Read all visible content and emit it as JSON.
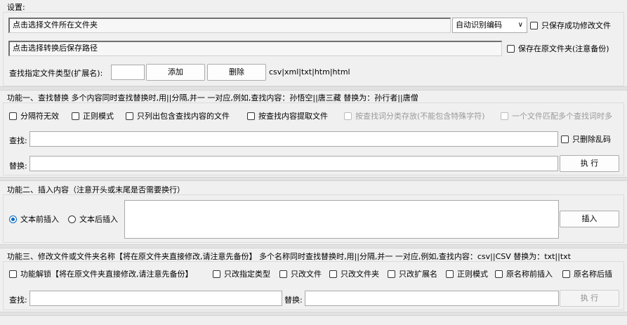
{
  "settings": {
    "title": "设置:",
    "source_path": "点击选择文件所在文件夹",
    "encoding": "自动识别编码",
    "encoding_chevron": "∨",
    "only_save_success": "只保存成功修改文件",
    "target_path": "点击选择转换后保存路径",
    "save_in_original": "保存在原文件夹(注意备份)",
    "ext_label": "查找指定文件类型(扩展名):",
    "ext_value": "",
    "add_btn": "添加",
    "delete_btn": "删除",
    "ext_list": "csv|xml|txt|htm|html"
  },
  "f1": {
    "title": "功能一、查找替换 多个内容同时查找替换时,用||分隔,并一 一对应,例如,查找内容：孙悟空||唐三藏 替换为：孙行者||唐僧",
    "opt_sep_invalid": "分隔符无效",
    "opt_regex": "正则模式",
    "opt_list_only": "只列出包含查找内容的文件",
    "opt_extract": "按查找内容提取文件",
    "opt_classify": "按查找词分类存放(不能包含特殊字符)",
    "opt_multi": "一个文件匹配多个查找词时多",
    "find_label": "查找:",
    "find_value": "",
    "only_delete_garbled": "只删除乱码",
    "replace_label": "替换:",
    "replace_value": "",
    "exec_btn": "执 行"
  },
  "f2": {
    "title": "功能二、插入内容（注意开头或末尾是否需要换行）",
    "radio_before": "文本前插入",
    "radio_after": "文本后插入",
    "content": "",
    "insert_btn": "插入"
  },
  "f3": {
    "title": "功能三、修改文件或文件夹名称【将在原文件夹直接修改,请注意先备份】 多个名称同时查找替换时,用||分隔,并一 一对应,例如,查找内容：csv||CSV 替换为：txt||txt",
    "opt_unlock": "功能解锁【将在原文件夹直接修改,请注意先备份】",
    "opt_type": "只改指定类型",
    "opt_file": "只改文件",
    "opt_folder": "只改文件夹",
    "opt_ext": "只改扩展名",
    "opt_regex": "正则模式",
    "opt_prefix": "原名称前插入",
    "opt_suffix": "原名称后插",
    "find_label": "查找:",
    "find_value": "",
    "replace_label": "替换:",
    "replace_value": "",
    "exec_btn": "执 行"
  }
}
